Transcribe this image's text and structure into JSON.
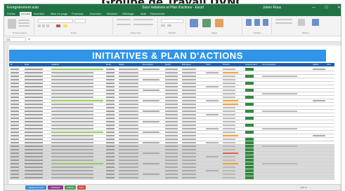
{
  "caption": "Groupe de Travail DVNC",
  "window": {
    "title": "Suivi Initiatives et Plan d'actions - Excel",
    "quick_access": "Enregistrement auto",
    "user": "Julien Roux",
    "controls": "— ☐ ✕"
  },
  "ribbon_tabs": [
    "Fichier",
    "Accueil",
    "Insertion",
    "Mise en page",
    "Formules",
    "Données",
    "Révision",
    "Affichage",
    "Aide",
    "Rechercher"
  ],
  "active_tab_index": 1,
  "ribbon_groups": [
    "Presse-papiers",
    "Police",
    "Alignement",
    "Nombre",
    "Styles",
    "Cellules",
    "Édition"
  ],
  "formula_bar": {
    "name_box": "A1",
    "fx": "fx"
  },
  "banner": {
    "title": "INITIATIVES & PLAN D'ACTIONS"
  },
  "table": {
    "headers": [
      "N°",
      "Date",
      "Initiative",
      "Resp.",
      "Statut",
      "Description",
      "Début",
      "Échéance",
      "Suivi",
      "Priorité",
      "Avancement",
      "Commentaires",
      "Validé",
      "Obs."
    ]
  },
  "sheet_tabs": [
    "Tableau de bord",
    "Initiatives",
    "Actions",
    "Suivi"
  ],
  "colors": {
    "excel_green": "#217346",
    "banner_blue": "#2f95e8",
    "header_blue": "#1f5fa8",
    "tab_blue": "#3c8fd6",
    "tab_purple": "#8e3f8e",
    "tab_green": "#4f9d5c",
    "tab_red": "#d24b3f",
    "orange": "#f0a030",
    "light_green": "#8fce5a",
    "status_green": "#2f8a3e",
    "grey_band": "#d9d9d9"
  },
  "zoom": "100 %"
}
